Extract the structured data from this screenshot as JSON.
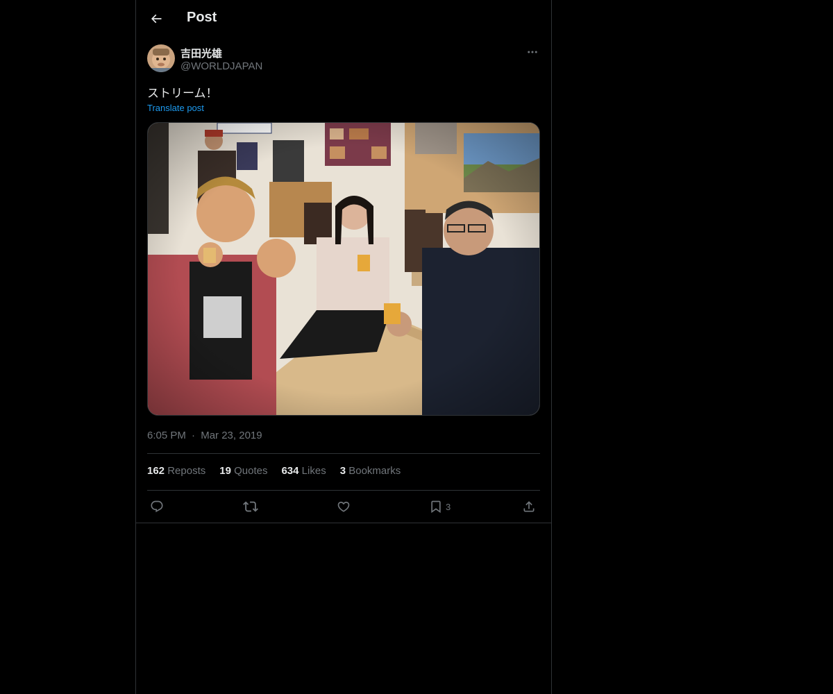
{
  "header": {
    "title": "Post",
    "back_icon": "arrow-left-icon"
  },
  "post": {
    "author": {
      "display_name": "吉田光雄",
      "handle": "@WORLDJAPAN"
    },
    "text": "ストリーム！",
    "translate_label": "Translate post",
    "time": "6:05 PM",
    "separator": "·",
    "date": "Mar 23, 2019",
    "media_alt": "photo"
  },
  "stats": {
    "reposts_count": "162",
    "reposts_label": "Repost",
    "reposts_suffix": "s",
    "quotes_count": "19",
    "quotes_label": "Quotes",
    "likes_count": "634",
    "likes_label": "Likes",
    "bookmarks_count": "3",
    "bookmarks_label": "Bookmarks"
  },
  "actions": {
    "reply_icon": "reply-icon",
    "repost_icon": "repost-icon",
    "like_icon": "heart-icon",
    "bookmark_icon": "bookmark-icon",
    "bookmark_count": "3",
    "share_icon": "share-icon"
  },
  "colors": {
    "background": "#000000",
    "text_primary": "#e7e9ea",
    "text_secondary": "#71767b",
    "accent": "#1d9bf0",
    "border": "#2f3336"
  }
}
